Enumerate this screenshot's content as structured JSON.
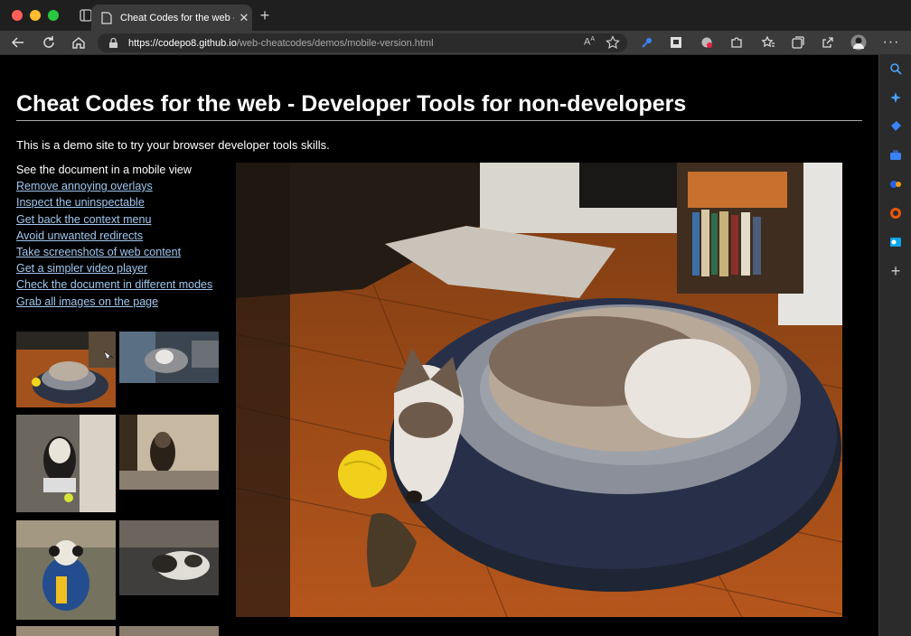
{
  "tab": {
    "title": "Cheat Codes for the web - Developer Tools for non-developers"
  },
  "address_bar": {
    "url_host": "https://codepo8.github.io",
    "url_path": "/web-cheatcodes/demos/mobile-version.html"
  },
  "page": {
    "heading": "Cheat Codes for the web - Developer Tools for non-developers",
    "intro": "This is a demo site to try your browser developer tools skills.",
    "nav_head": "See the document in a mobile view",
    "links": [
      "Remove annoying overlays",
      "Inspect the uninspectable",
      "Get back the context menu",
      "Avoid unwanted redirects",
      "Take screenshots of web content",
      "Get a simpler video player",
      "Check the document in different modes",
      "Grab all images on the page"
    ]
  },
  "colors": {
    "link": "#9fc8f0",
    "page_background": "#000000",
    "chrome": "#3b3b3b"
  }
}
